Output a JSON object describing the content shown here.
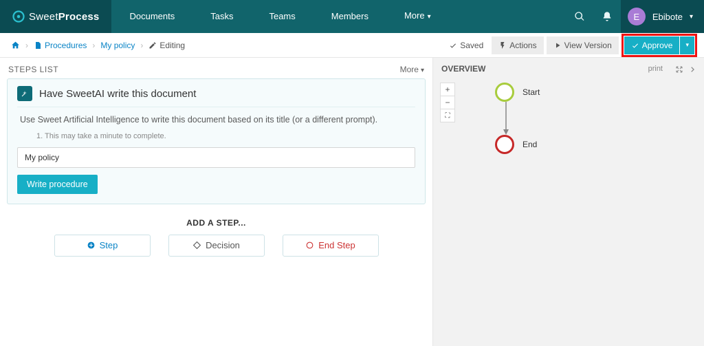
{
  "brand": {
    "icon_name": "wheel-icon",
    "name_light": "Sweet",
    "name_bold": "Process"
  },
  "nav": {
    "items": [
      "Documents",
      "Tasks",
      "Teams",
      "Members"
    ],
    "more_label": "More"
  },
  "user": {
    "initial": "E",
    "name": "Ebibote"
  },
  "breadcrumb": {
    "home_icon": "home",
    "procedures": "Procedures",
    "policy": "My policy",
    "editing": "Editing"
  },
  "actionbar": {
    "saved": "Saved",
    "actions": "Actions",
    "view_version": "View Version",
    "approve": "Approve"
  },
  "steps_panel": {
    "title": "STEPS LIST",
    "more": "More",
    "ai_card": {
      "title": "Have SweetAI write this document",
      "desc": "Use Sweet Artificial Intelligence to write this document based on its title (or a different prompt).",
      "note": "1. This may take a minute to complete.",
      "input_value": "My policy",
      "submit": "Write procedure"
    },
    "add_step_title": "ADD A STEP...",
    "buttons": {
      "step": "Step",
      "decision": "Decision",
      "end": "End Step"
    }
  },
  "overview": {
    "title": "OVERVIEW",
    "print": "print",
    "start": "Start",
    "end": "End"
  }
}
